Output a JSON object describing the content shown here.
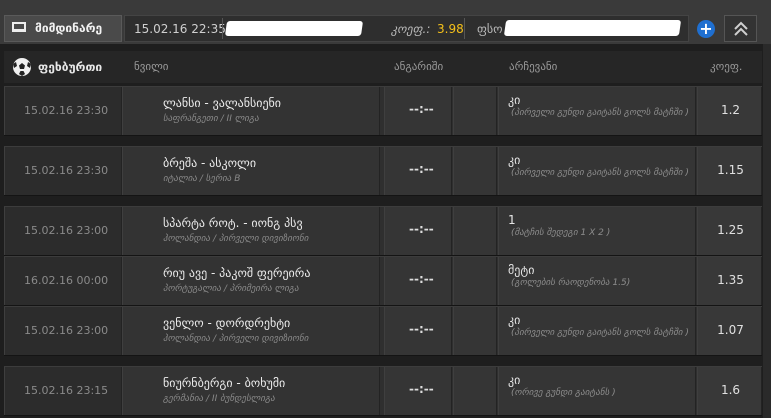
{
  "topbar": {
    "tab_label": "მიმდინარე",
    "datetime": "15.02.16 22:35",
    "odds_label": "კოეფ.:",
    "odds_value": "3.98",
    "fso_label": "ფსო",
    "add_symbol": "+"
  },
  "header": {
    "sport": "ფეხბურთი",
    "col_event": "ნვილი",
    "col_score": "ანგარიში",
    "col_pick": "არჩევანი",
    "col_odds": "კოეფ."
  },
  "rows": [
    {
      "date": "15.02.16 23:30",
      "teams": "ლანსი - ვალანსიენი",
      "league": "საფრანგეთი / II ლიგა",
      "score": "--:--",
      "pick": "კი",
      "pick_desc": "(პირველი გუნდი გაიტანს გოლს მატჩში )",
      "odd": "1.2"
    },
    {
      "date": "15.02.16 23:30",
      "teams": "ბრეშა - ასკოლი",
      "league": "იტალია / სერია B",
      "score": "--:--",
      "pick": "კი",
      "pick_desc": "(პირველი გუნდი გაიტანს გოლს მატჩში )",
      "odd": "1.15"
    },
    {
      "date": "15.02.16 23:00",
      "teams": "სპარტა როტ. - იონგ პსვ",
      "league": "ჰოლანდია / პირველი დივიზიონი",
      "score": "--:--",
      "pick": "1",
      "pick_desc": "(მატჩის შედეგი 1 X 2 )",
      "odd": "1.25"
    },
    {
      "date": "16.02.16 00:00",
      "teams": "რიუ ავე - პაკოშ ფერეირა",
      "league": "პორტუგალია / პრიმეირა ლიგა",
      "score": "--:--",
      "pick": "მეტი",
      "pick_desc": "(გოლების რაოდენობა 1.5)",
      "odd": "1.35"
    },
    {
      "date": "15.02.16 23:00",
      "teams": "ვენლო - დორდრეხტი",
      "league": "ჰოლანდია / პირველი დივიზიონი",
      "score": "--:--",
      "pick": "კი",
      "pick_desc": "(პირველი გუნდი გაიტანს გოლს მატჩში )",
      "odd": "1.07"
    },
    {
      "date": "15.02.16 23:15",
      "teams": "ნიურნბერგი - ბოხუმი",
      "league": "გერმანია / II ბუნდესლიგა",
      "score": "--:--",
      "pick": "კი",
      "pick_desc": "(ორივე გუნდი გაიტანს )",
      "odd": "1.6"
    }
  ],
  "colors": {
    "accent": "#f4c01a",
    "plus_button": "#1f6fd0",
    "background": "#1e1e1e"
  }
}
